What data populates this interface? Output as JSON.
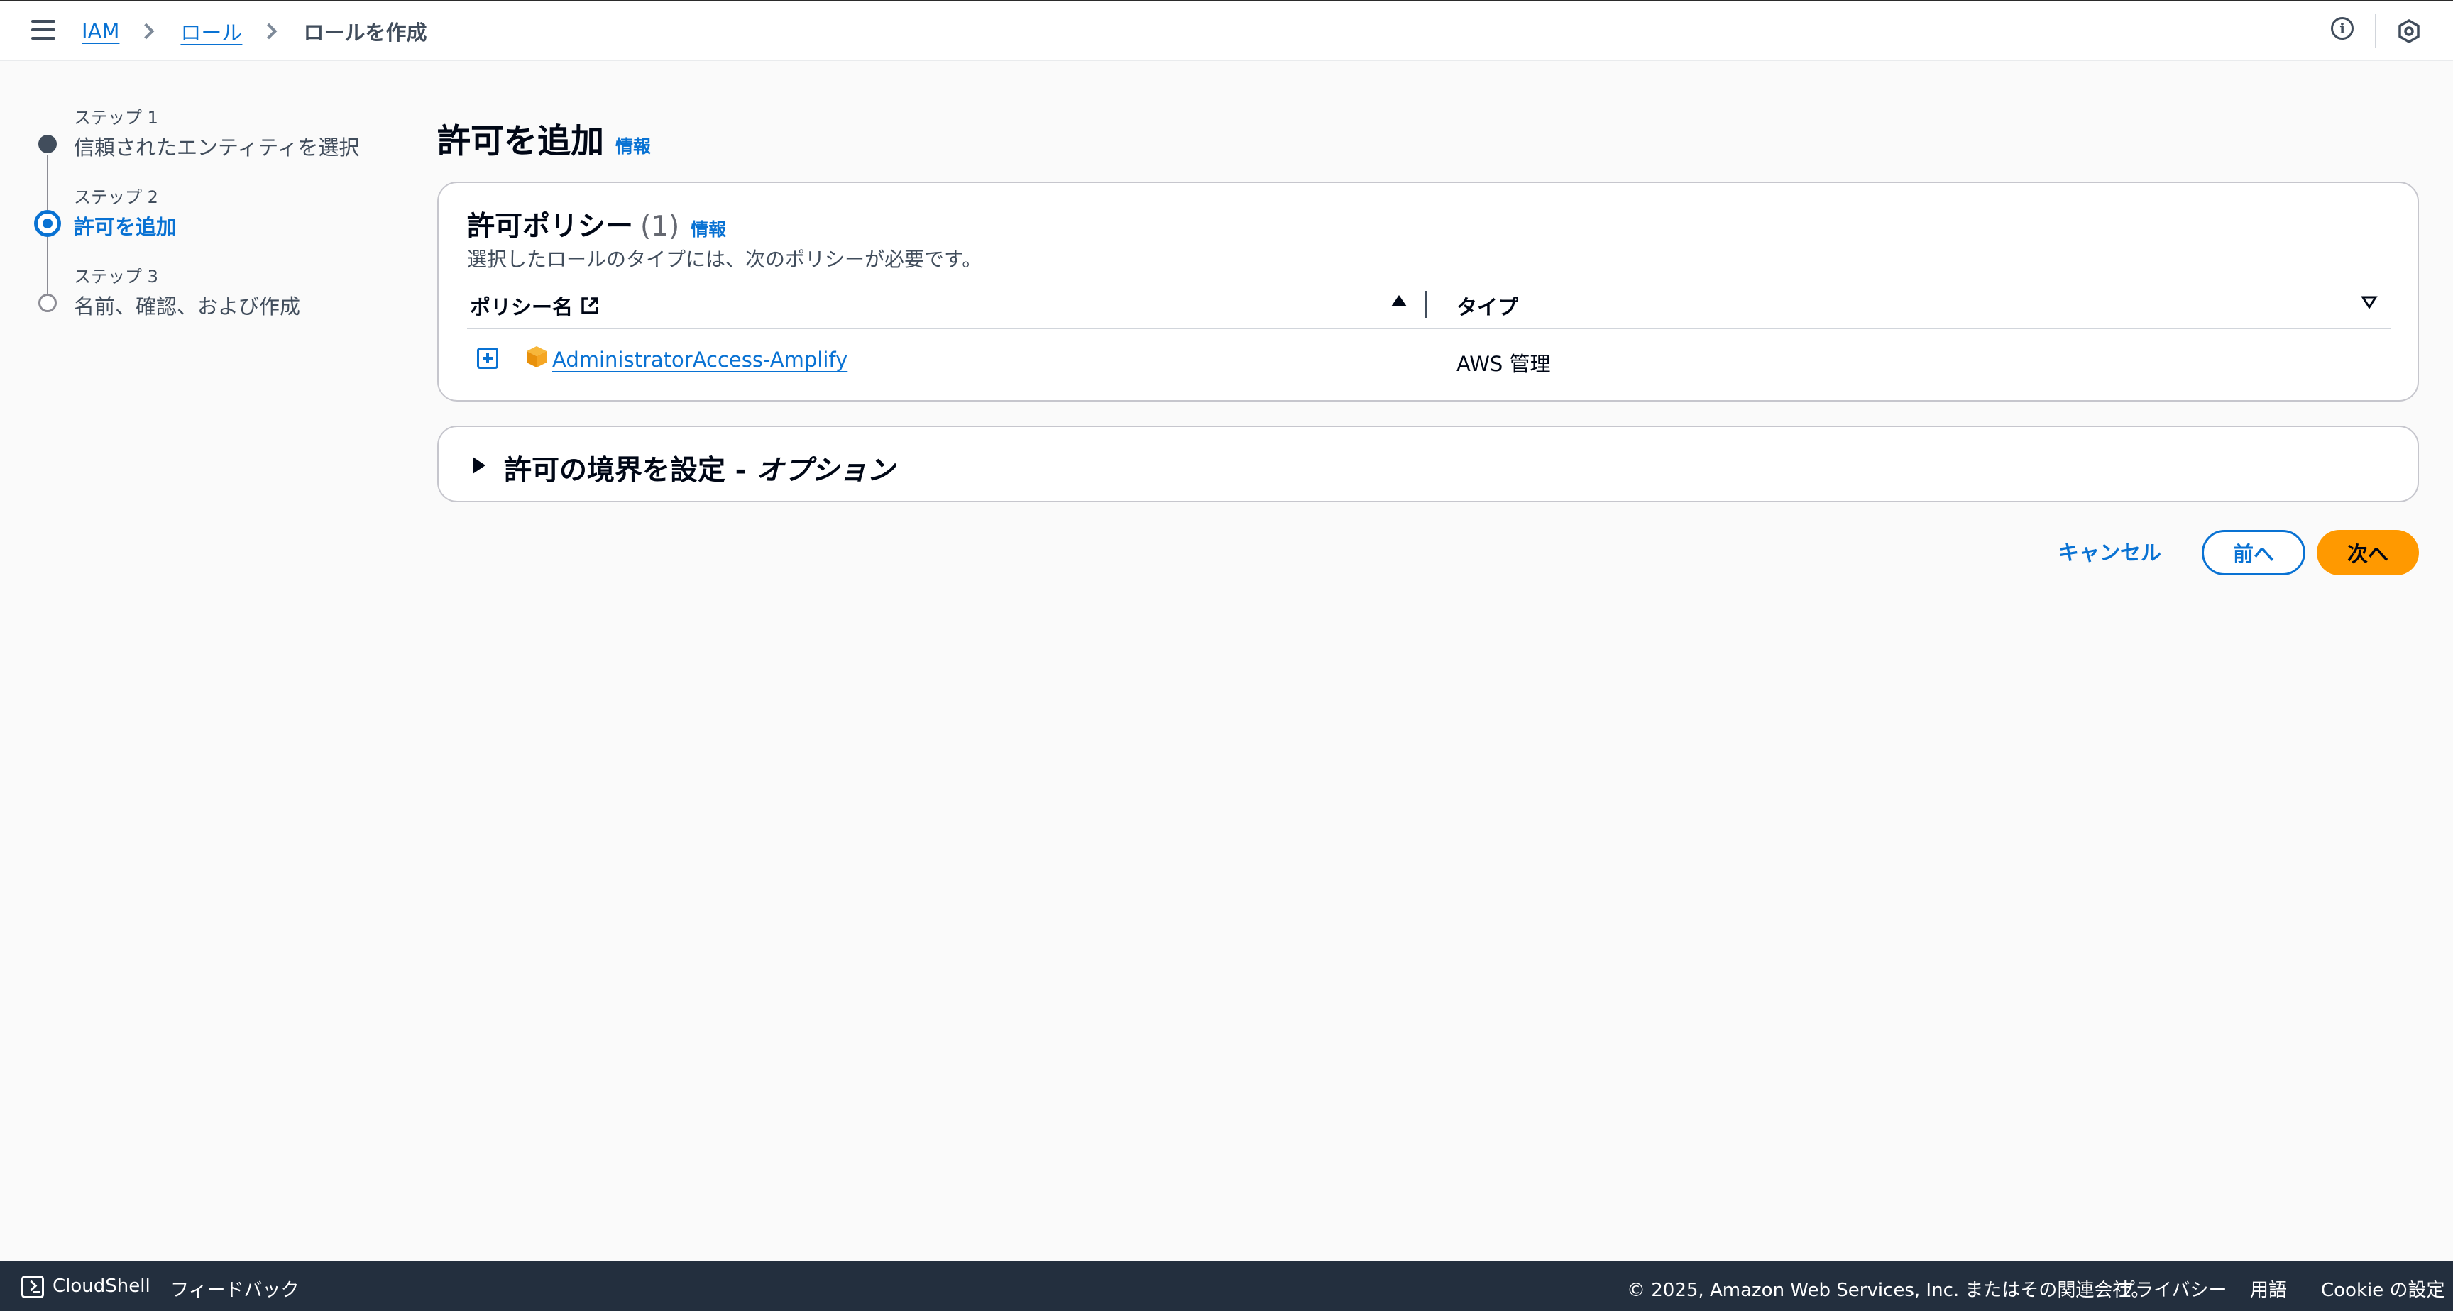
{
  "breadcrumb": {
    "items": [
      {
        "label": "IAM",
        "link": true
      },
      {
        "label": "ロール",
        "link": true
      },
      {
        "label": "ロールを作成",
        "link": false
      }
    ]
  },
  "steps": [
    {
      "label": "ステップ 1",
      "title": "信頼されたエンティティを選択",
      "state": "done"
    },
    {
      "label": "ステップ 2",
      "title": "許可を追加",
      "state": "active"
    },
    {
      "label": "ステップ 3",
      "title": "名前、確認、および作成",
      "state": "todo"
    }
  ],
  "page": {
    "title": "許可を追加",
    "info_link": "情報"
  },
  "policy_card": {
    "title": "許可ポリシー",
    "count": "(1)",
    "info_link": "情報",
    "description": "選択したロールのタイプには、次のポリシーが必要です。",
    "columns": [
      "ポリシー名",
      "タイプ"
    ],
    "rows": [
      {
        "name": "AdministratorAccess-Amplify",
        "type": "AWS 管理"
      }
    ]
  },
  "boundary_card": {
    "title": "許可の境界を設定 - ",
    "title_italic": "オプション"
  },
  "actions": {
    "cancel": "キャンセル",
    "previous": "前へ",
    "next": "次へ"
  },
  "footer": {
    "cloudshell": "CloudShell",
    "feedback": "フィードバック",
    "copyright": "© 2025, Amazon Web Services, Inc. またはその関連会社。",
    "privacy": "プライバシー",
    "terms": "用語",
    "cookies": "Cookie の設定"
  },
  "colors": {
    "link": "#0972d3",
    "primary_button": "#ff9900",
    "footer_bg": "#232f3e"
  }
}
